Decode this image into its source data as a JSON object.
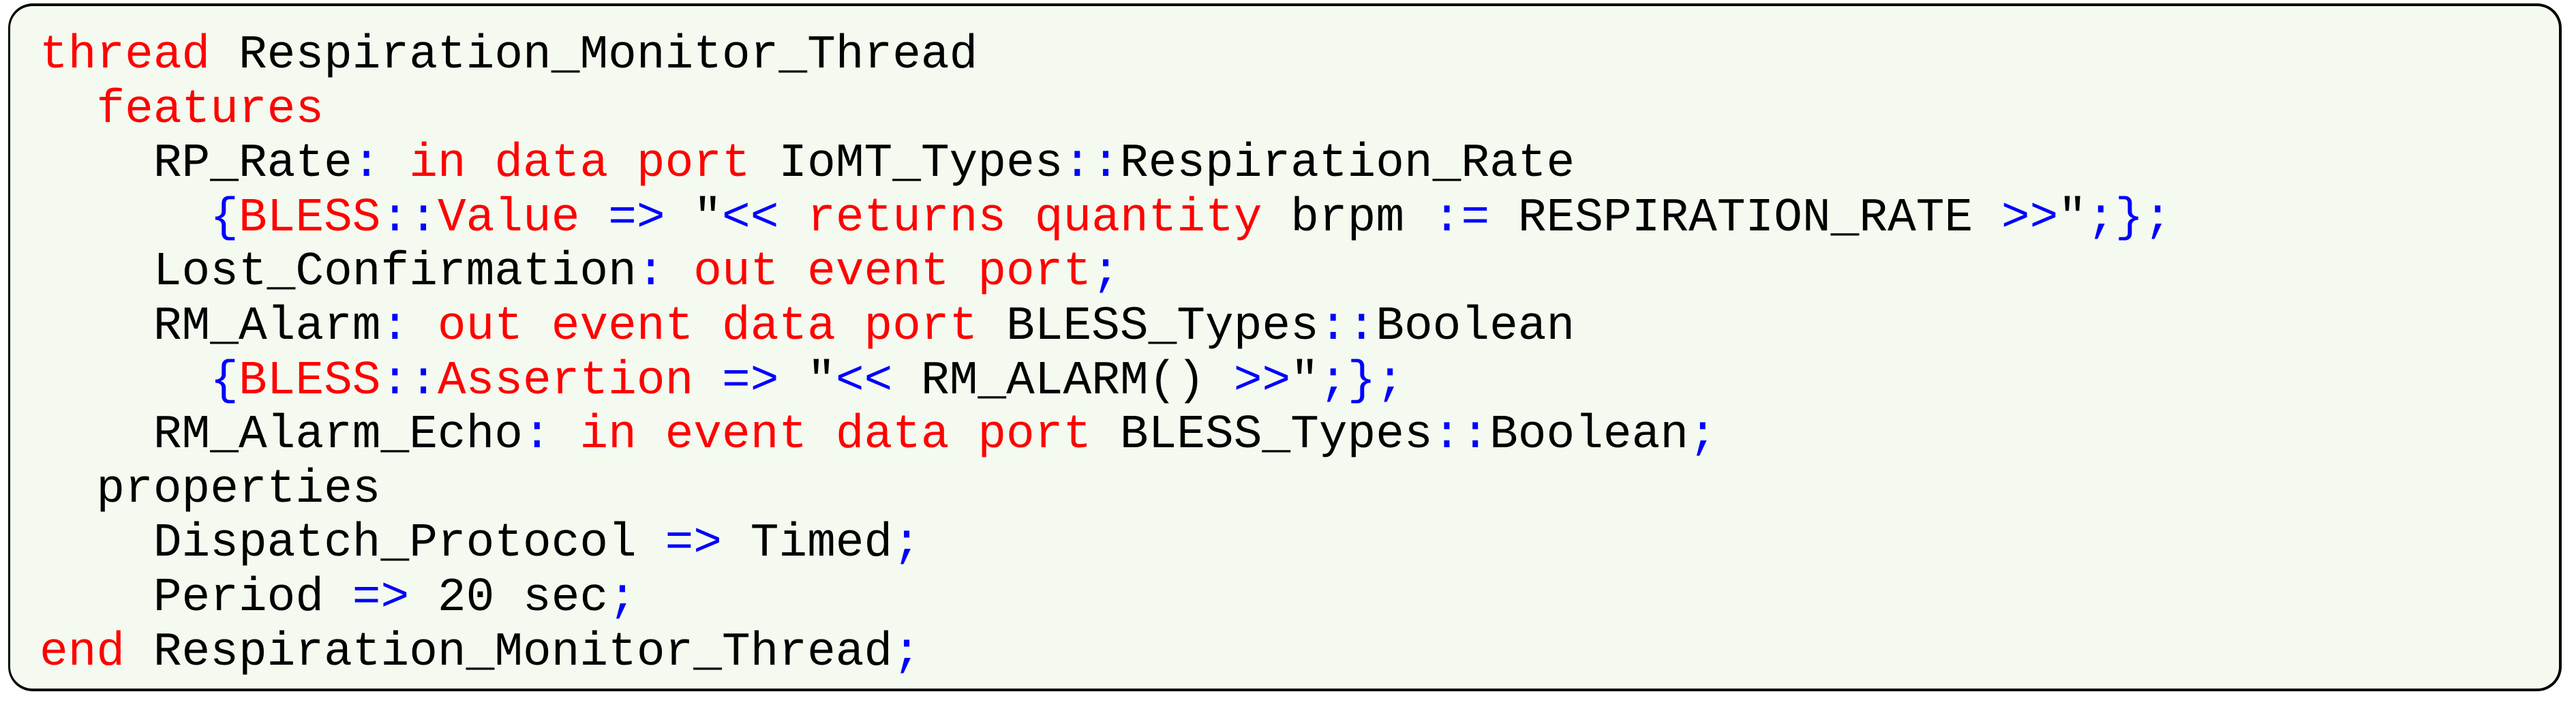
{
  "colors": {
    "background": "#f4faf0",
    "border": "#000000",
    "identifier": "#000000",
    "keyword": "#ff0000",
    "symbol": "#0000ff"
  },
  "code": {
    "language": "AADL/BLESS",
    "lines": [
      {
        "tokens": [
          {
            "t": "thread",
            "k": "kw"
          },
          {
            "t": " Respiration_Monitor_Thread",
            "k": "id"
          }
        ]
      },
      {
        "tokens": [
          {
            "t": "  ",
            "k": "id"
          },
          {
            "t": "features",
            "k": "kw"
          }
        ]
      },
      {
        "tokens": [
          {
            "t": "    RP_Rate",
            "k": "id"
          },
          {
            "t": ":",
            "k": "sym"
          },
          {
            "t": " ",
            "k": "id"
          },
          {
            "t": "in data port",
            "k": "kw"
          },
          {
            "t": " IoMT_Types",
            "k": "id"
          },
          {
            "t": "::",
            "k": "sym"
          },
          {
            "t": "Respiration_Rate",
            "k": "id"
          }
        ]
      },
      {
        "tokens": [
          {
            "t": "      ",
            "k": "id"
          },
          {
            "t": "{",
            "k": "sym"
          },
          {
            "t": "BLESS",
            "k": "kw"
          },
          {
            "t": "::",
            "k": "sym"
          },
          {
            "t": "Value",
            "k": "kw"
          },
          {
            "t": " ",
            "k": "id"
          },
          {
            "t": "=>",
            "k": "sym"
          },
          {
            "t": " \"",
            "k": "id"
          },
          {
            "t": "<<",
            "k": "sym"
          },
          {
            "t": " ",
            "k": "id"
          },
          {
            "t": "returns quantity",
            "k": "kw"
          },
          {
            "t": " brpm ",
            "k": "id"
          },
          {
            "t": ":=",
            "k": "sym"
          },
          {
            "t": " RESPIRATION_RATE ",
            "k": "id"
          },
          {
            "t": ">>",
            "k": "sym"
          },
          {
            "t": "\"",
            "k": "id"
          },
          {
            "t": ";};",
            "k": "sym"
          }
        ]
      },
      {
        "tokens": [
          {
            "t": "    Lost_Confirmation",
            "k": "id"
          },
          {
            "t": ":",
            "k": "sym"
          },
          {
            "t": " ",
            "k": "id"
          },
          {
            "t": "out event port",
            "k": "kw"
          },
          {
            "t": ";",
            "k": "sym"
          }
        ]
      },
      {
        "tokens": [
          {
            "t": "    RM_Alarm",
            "k": "id"
          },
          {
            "t": ":",
            "k": "sym"
          },
          {
            "t": " ",
            "k": "id"
          },
          {
            "t": "out event data port",
            "k": "kw"
          },
          {
            "t": " BLESS_Types",
            "k": "id"
          },
          {
            "t": "::",
            "k": "sym"
          },
          {
            "t": "Boolean",
            "k": "id"
          }
        ]
      },
      {
        "tokens": [
          {
            "t": "      ",
            "k": "id"
          },
          {
            "t": "{",
            "k": "sym"
          },
          {
            "t": "BLESS",
            "k": "kw"
          },
          {
            "t": "::",
            "k": "sym"
          },
          {
            "t": "Assertion",
            "k": "kw"
          },
          {
            "t": " ",
            "k": "id"
          },
          {
            "t": "=>",
            "k": "sym"
          },
          {
            "t": " \"",
            "k": "id"
          },
          {
            "t": "<<",
            "k": "sym"
          },
          {
            "t": " RM_ALARM() ",
            "k": "id"
          },
          {
            "t": ">>",
            "k": "sym"
          },
          {
            "t": "\"",
            "k": "id"
          },
          {
            "t": ";};",
            "k": "sym"
          }
        ]
      },
      {
        "tokens": [
          {
            "t": "    RM_Alarm_Echo",
            "k": "id"
          },
          {
            "t": ":",
            "k": "sym"
          },
          {
            "t": " ",
            "k": "id"
          },
          {
            "t": "in event data port",
            "k": "kw"
          },
          {
            "t": " BLESS_Types",
            "k": "id"
          },
          {
            "t": "::",
            "k": "sym"
          },
          {
            "t": "Boolean",
            "k": "id"
          },
          {
            "t": ";",
            "k": "sym"
          }
        ]
      },
      {
        "tokens": [
          {
            "t": "  properties",
            "k": "id"
          }
        ]
      },
      {
        "tokens": [
          {
            "t": "    Dispatch_Protocol ",
            "k": "id"
          },
          {
            "t": "=>",
            "k": "sym"
          },
          {
            "t": " Timed",
            "k": "id"
          },
          {
            "t": ";",
            "k": "sym"
          }
        ]
      },
      {
        "tokens": [
          {
            "t": "    Period ",
            "k": "id"
          },
          {
            "t": "=>",
            "k": "sym"
          },
          {
            "t": " 20 sec",
            "k": "id"
          },
          {
            "t": ";",
            "k": "sym"
          }
        ]
      },
      {
        "tokens": [
          {
            "t": "end",
            "k": "kw"
          },
          {
            "t": " Respiration_Monitor_Thread",
            "k": "id"
          },
          {
            "t": ";",
            "k": "sym"
          }
        ]
      }
    ]
  }
}
